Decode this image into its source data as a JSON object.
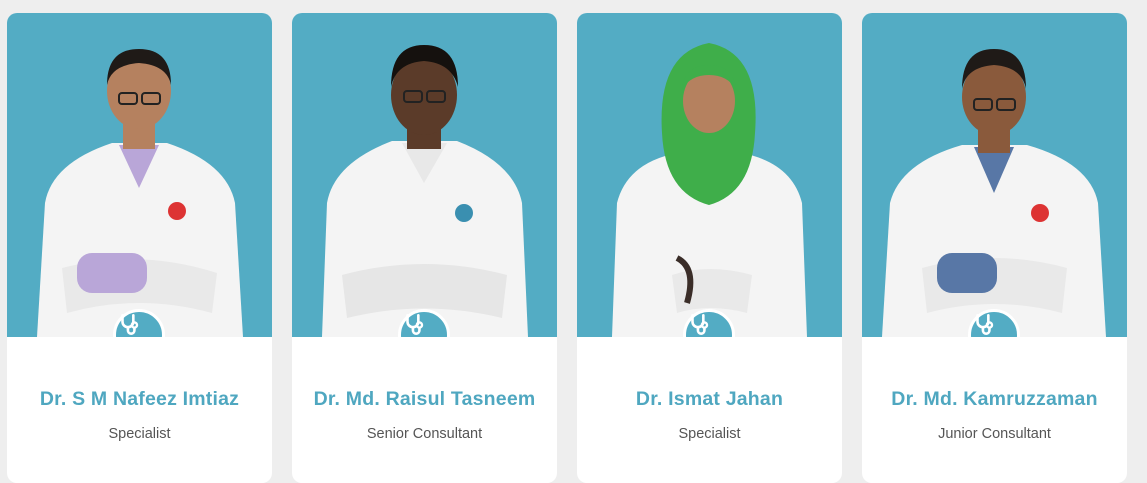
{
  "colors": {
    "accent": "#53acc4",
    "name_text": "#4fa7c0",
    "role_text": "#555555"
  },
  "doctors": [
    {
      "name": "Dr. S M Nafeez Imtiaz",
      "role": "Specialist",
      "icon": "stethoscope-icon",
      "shirt": "#b9a6d8"
    },
    {
      "name": "Dr. Md. Raisul Tasneem",
      "role": "Senior Consultant",
      "icon": "stethoscope-icon",
      "shirt": "#f2f2f2"
    },
    {
      "name": "Dr. Ismat Jahan",
      "role": "Specialist",
      "icon": "stethoscope-icon",
      "shirt": "#3fae4a"
    },
    {
      "name": "Dr. Md. Kamruzzaman",
      "role": "Junior Consultant",
      "icon": "stethoscope-icon",
      "shirt": "#5877a6"
    }
  ]
}
